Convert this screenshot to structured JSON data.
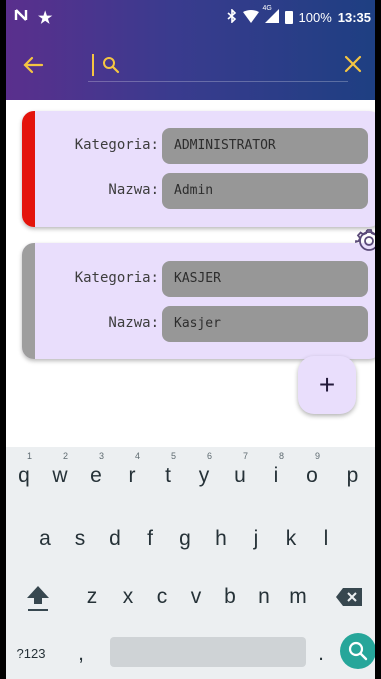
{
  "status_bar": {
    "battery_percent": "100%",
    "time": "13:35",
    "network": "4G"
  },
  "app_bar": {
    "back_icon": "arrow-left-icon",
    "search_icon": "search-icon",
    "search_value": "",
    "close_icon": "close-icon"
  },
  "records": [
    {
      "accent_color": "#e4140c",
      "fields": [
        {
          "label": "Kategoria:",
          "value": "ADMINISTRATOR"
        },
        {
          "label": "Nazwa:",
          "value": "Admin"
        }
      ]
    },
    {
      "accent_color": "#9e9e9e",
      "fields": [
        {
          "label": "Kategoria:",
          "value": "KASJER"
        },
        {
          "label": "Nazwa:",
          "value": "Kasjer"
        }
      ]
    }
  ],
  "settings_icon": "gear-icon",
  "fab": {
    "label": "+"
  },
  "keyboard": {
    "row1": [
      {
        "key": "q",
        "hint": "1"
      },
      {
        "key": "w",
        "hint": "2"
      },
      {
        "key": "e",
        "hint": "3"
      },
      {
        "key": "r",
        "hint": "4"
      },
      {
        "key": "t",
        "hint": "5"
      },
      {
        "key": "y",
        "hint": "6"
      },
      {
        "key": "u",
        "hint": "7"
      },
      {
        "key": "i",
        "hint": "8"
      },
      {
        "key": "o",
        "hint": "9"
      },
      {
        "key": "p",
        "hint": ""
      }
    ],
    "row2": [
      "a",
      "s",
      "d",
      "f",
      "g",
      "h",
      "j",
      "k",
      "l"
    ],
    "row3": [
      "z",
      "x",
      "c",
      "v",
      "b",
      "n",
      "m"
    ],
    "symbols_key": "?123",
    "comma_key": ",",
    "period_key": "."
  },
  "colors": {
    "accent_yellow": "#f5c542",
    "card_background": "#e9defc",
    "value_background": "#979797",
    "search_key": "#26a69a"
  }
}
